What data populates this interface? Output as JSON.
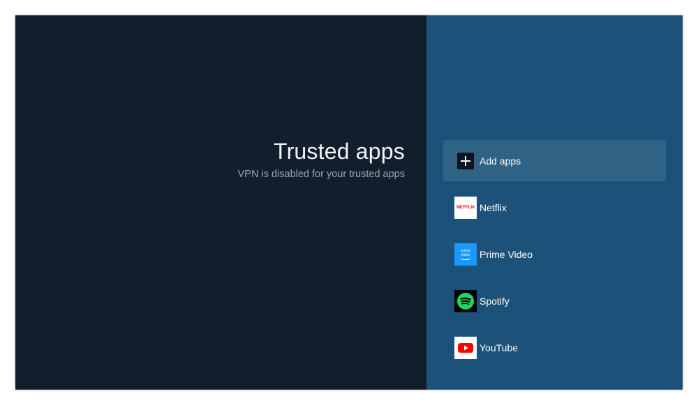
{
  "header": {
    "title": "Trusted apps",
    "subtitle": "VPN is disabled for your trusted apps"
  },
  "menu": {
    "items": [
      {
        "label": "Add apps",
        "icon": "add-icon",
        "focused": true
      },
      {
        "label": "Netflix",
        "icon": "netflix-icon",
        "icon_text": "NETFLIX"
      },
      {
        "label": "Prime Video",
        "icon": "prime-video-icon",
        "icon_text_top": "prime",
        "icon_text_bottom": "video"
      },
      {
        "label": "Spotify",
        "icon": "spotify-icon"
      },
      {
        "label": "YouTube",
        "icon": "youtube-icon"
      }
    ]
  },
  "colors": {
    "left_background": "#111f2c",
    "right_background": "#1c5279",
    "focused_item": "#2f6285",
    "netflix_red": "#e50914",
    "prime_blue": "#1a98ff",
    "spotify_green": "#1ed760",
    "youtube_red": "#ff0000"
  }
}
